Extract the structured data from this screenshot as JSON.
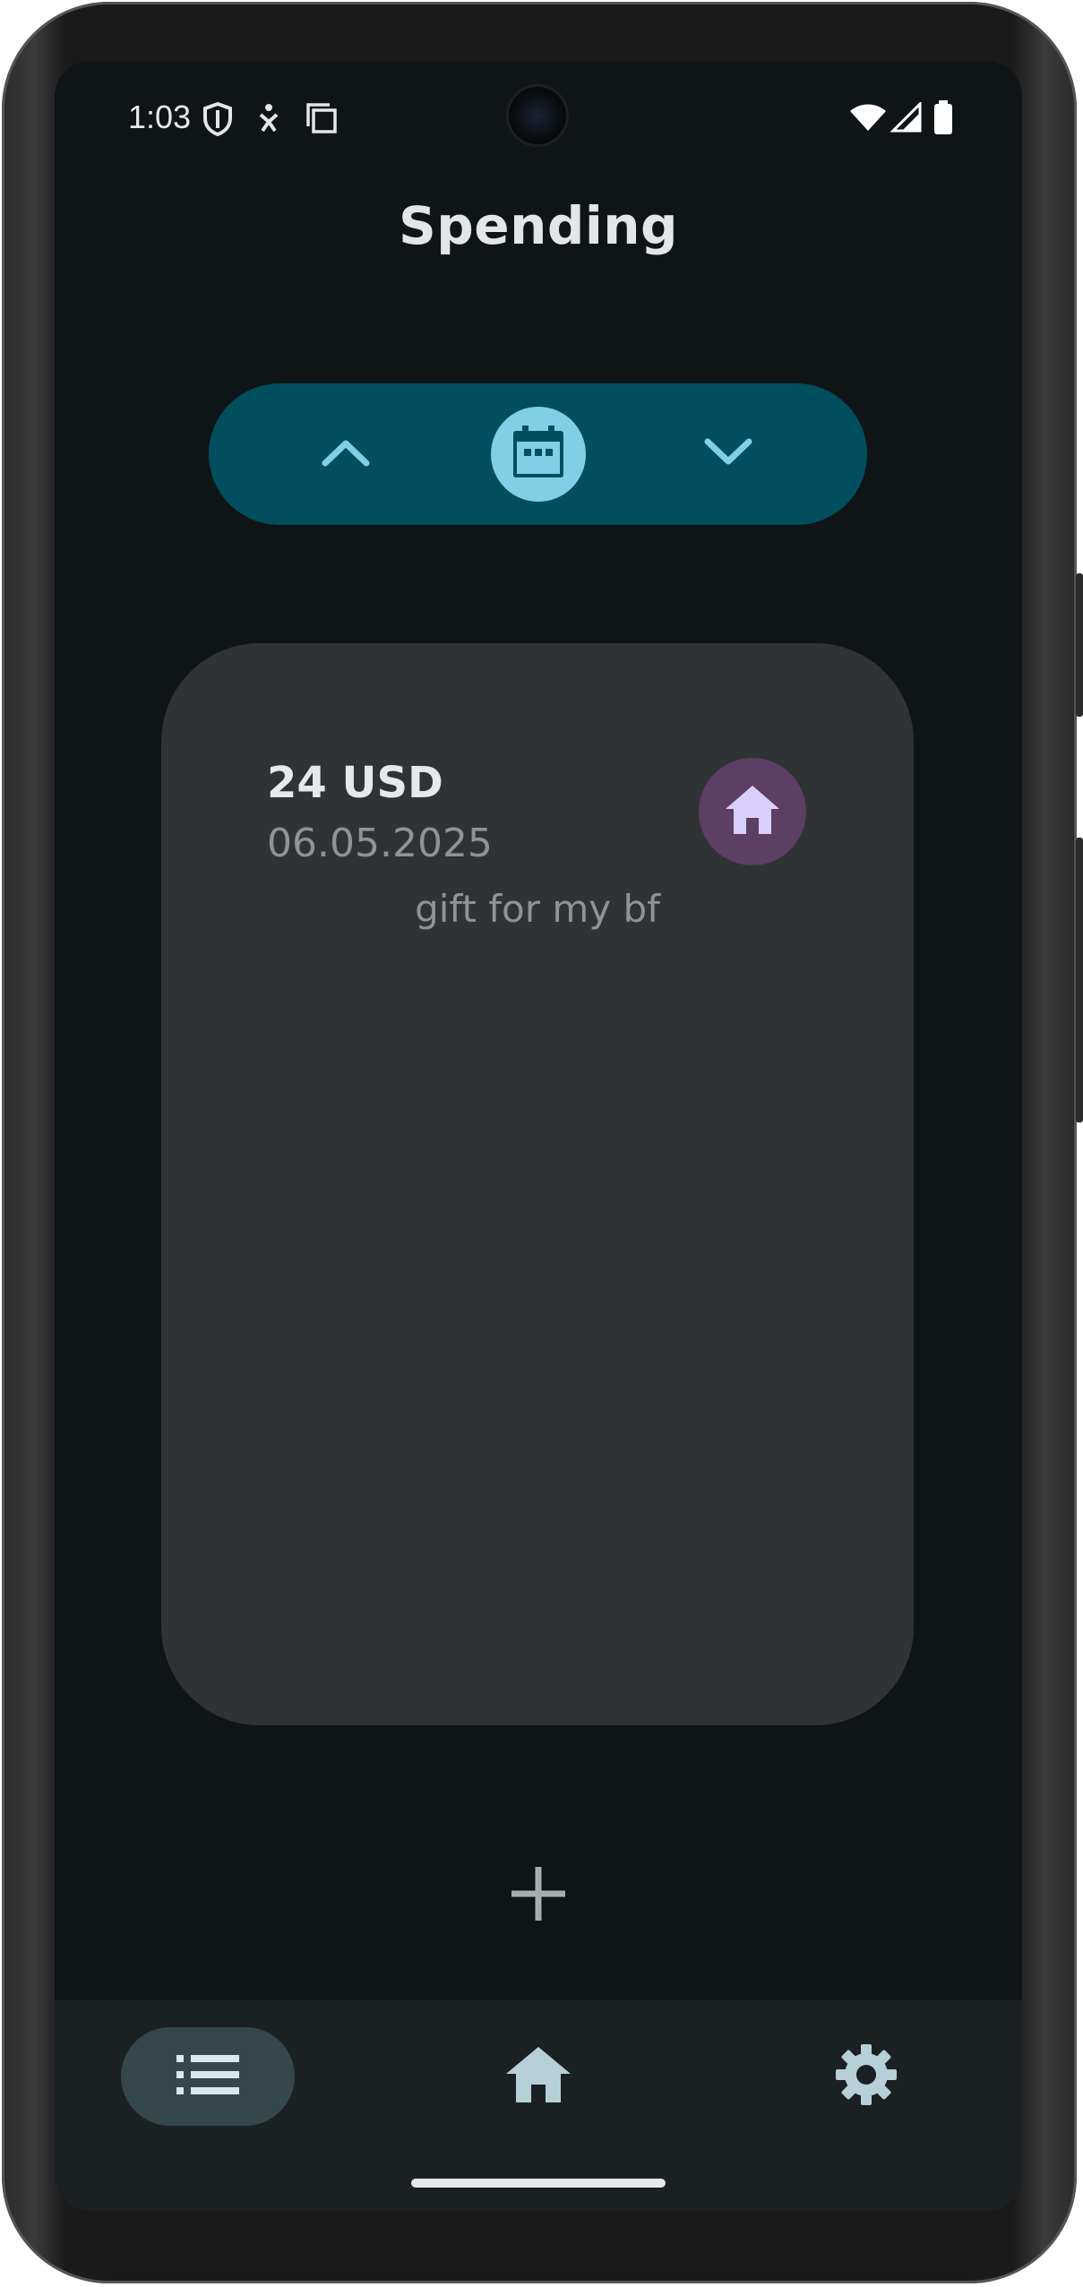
{
  "status_bar": {
    "time": "1:03",
    "icons": [
      "shield-icon",
      "accessibility-icon",
      "copy-icon",
      "wifi-icon",
      "signal-icon",
      "battery-icon"
    ]
  },
  "header": {
    "title": "Spending"
  },
  "date_nav": {
    "prev_icon": "chevron-up-icon",
    "calendar_icon": "calendar-icon",
    "next_icon": "chevron-down-icon",
    "color": "#004e5e",
    "accent": "#7fd0e6"
  },
  "spending_card": {
    "amount": "24 USD",
    "date": "06.05.2025",
    "note": "gift for my bf",
    "category_icon": "home-icon",
    "category_color": "#5c3f63"
  },
  "add_button": {
    "icon": "plus-icon"
  },
  "bottom_nav": {
    "items": [
      {
        "icon": "list-icon",
        "active": true
      },
      {
        "icon": "home-icon",
        "active": false
      },
      {
        "icon": "gear-icon",
        "active": false
      }
    ]
  }
}
